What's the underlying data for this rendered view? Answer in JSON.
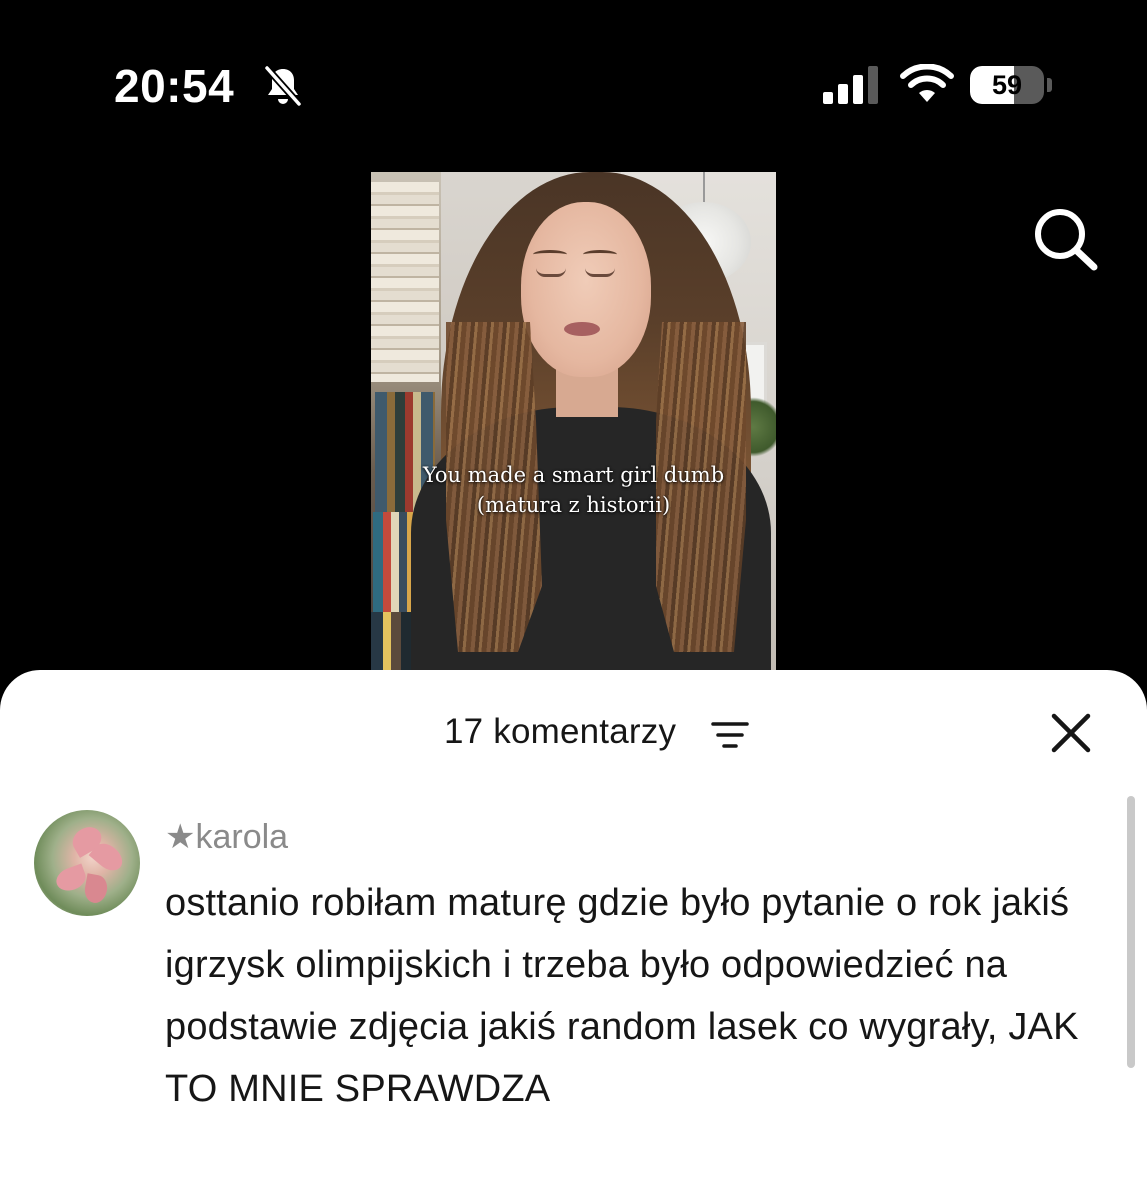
{
  "status_bar": {
    "time": "20:54",
    "battery_percent": "59",
    "battery_level": 0.59,
    "icons": [
      "bell-slash-icon",
      "cellular-signal-icon",
      "wifi-icon",
      "battery-icon"
    ],
    "signal_bars": 3
  },
  "video": {
    "overlay_line1": "You made a smart girl dumb",
    "overlay_line2": "(matura z historii)",
    "search_icon": "search-icon"
  },
  "comments_sheet": {
    "title": "17 komentarzy",
    "sort_icon": "sort-filter-icon",
    "close_icon": "close-icon",
    "comments": [
      {
        "username": "★karola",
        "text": "osttanio robiłam maturę gdzie było pytanie o rok jakiś igrzysk olimpijskich i trzeba było odpowiedzieć na podstawie zdjęcia jakiś random lasek co wygrały, JAK TO MNIE SPRAWDZA"
      }
    ]
  },
  "colors": {
    "background": "#000000",
    "sheet_background": "#ffffff",
    "text_primary": "#161616",
    "text_secondary": "#8a8a8a"
  }
}
